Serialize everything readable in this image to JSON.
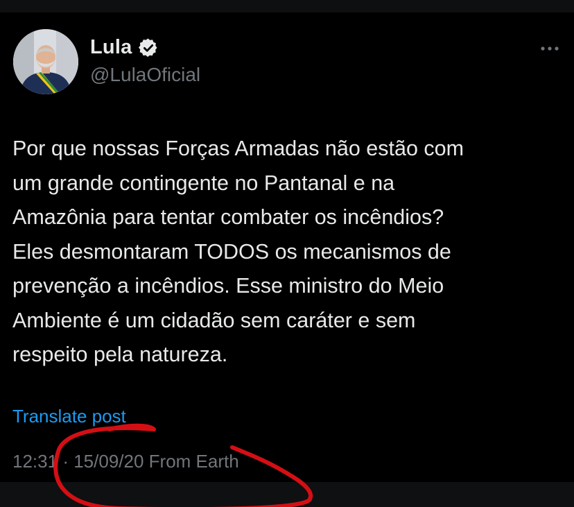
{
  "post": {
    "author": {
      "display_name": "Lula",
      "handle": "@LulaOficial",
      "verified_icon": "verified-badge-icon",
      "avatar": "profile-photo"
    },
    "more_icon": "more-options-icon",
    "text": "Por que nossas Forças Armadas não estão com\num grande contingente no Pantanal e na\nAmazônia para tentar combater os incêndios?\nEles desmontaram TODOS os mecanismos de\nprevenção a incêndios. Esse ministro do Meio\nAmbiente é um cidadão sem caráter e sem\nrespeito pela natureza.",
    "translate_label": "Translate post",
    "meta": {
      "time": "12:31",
      "separator": "·",
      "date": "15/09/20",
      "source": "From Earth"
    }
  },
  "colors": {
    "background": "#000000",
    "text": "#e7e9ea",
    "secondary": "#71767b",
    "link": "#1d9bf0",
    "annotation": "#d40f14"
  }
}
